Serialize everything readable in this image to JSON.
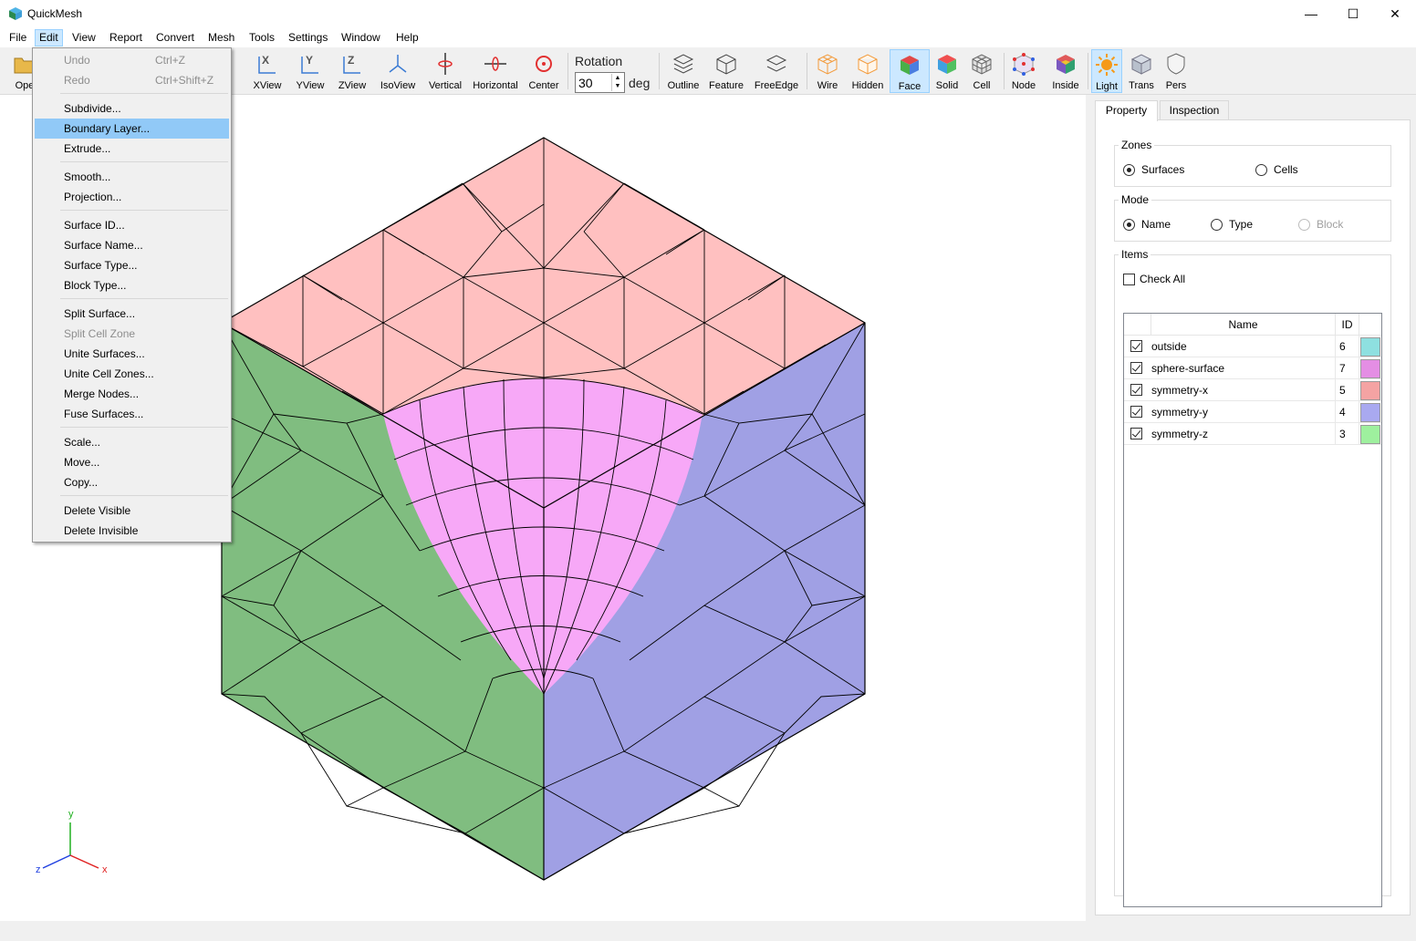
{
  "title": "QuickMesh",
  "menu": [
    "File",
    "Edit",
    "View",
    "Report",
    "Convert",
    "Mesh",
    "Tools",
    "Settings",
    "Window",
    "Help"
  ],
  "toolbar": {
    "open": "Ope",
    "views": [
      "XView",
      "YView",
      "ZView",
      "IsoView"
    ],
    "axes": [
      "Vertical",
      "Horizontal",
      "Center"
    ],
    "rotation_label": "Rotation",
    "rotation_value": "30",
    "rotation_unit": "deg",
    "display": [
      "Outline",
      "Feature",
      "FreeEdge"
    ],
    "render": [
      "Wire",
      "Hidden",
      "Face",
      "Solid",
      "Cell"
    ],
    "extra": [
      "Node",
      "Inside"
    ],
    "light": [
      "Light",
      "Trans",
      "Pers"
    ]
  },
  "edit_menu": {
    "undo": "Undo",
    "undo_sc": "Ctrl+Z",
    "redo": "Redo",
    "redo_sc": "Ctrl+Shift+Z",
    "subdivide": "Subdivide...",
    "boundary_layer": "Boundary Layer...",
    "extrude": "Extrude...",
    "smooth": "Smooth...",
    "projection": "Projection...",
    "surface_id": "Surface ID...",
    "surface_name": "Surface Name...",
    "surface_type": "Surface Type...",
    "block_type": "Block Type...",
    "split_surface": "Split Surface...",
    "split_cell_zone": "Split Cell Zone",
    "unite_surfaces": "Unite Surfaces...",
    "unite_cell_zones": "Unite Cell Zones...",
    "merge_nodes": "Merge Nodes...",
    "fuse_surfaces": "Fuse Surfaces...",
    "scale": "Scale...",
    "move": "Move...",
    "copy": "Copy...",
    "delete_visible": "Delete Visible",
    "delete_invisible": "Delete Invisible"
  },
  "panel": {
    "tabs": [
      "Property",
      "Inspection"
    ],
    "zones_title": "Zones",
    "zones": [
      "Surfaces",
      "Cells"
    ],
    "mode_title": "Mode",
    "mode": [
      "Name",
      "Type",
      "Block"
    ],
    "items_title": "Items",
    "check_all": "Check All",
    "col_name": "Name",
    "col_id": "ID",
    "rows": [
      {
        "name": "outside",
        "id": "6",
        "color": "#8ee0e0"
      },
      {
        "name": "sphere-surface",
        "id": "7",
        "color": "#e48ee4"
      },
      {
        "name": "symmetry-x",
        "id": "5",
        "color": "#f4a3a3"
      },
      {
        "name": "symmetry-y",
        "id": "4",
        "color": "#a9a9f0"
      },
      {
        "name": "symmetry-z",
        "id": "3",
        "color": "#9ef09e"
      }
    ]
  },
  "axes": {
    "y": "y",
    "x": "x",
    "z": "z"
  },
  "colors": {
    "top_face": "#ffc0c0",
    "left_face": "#80bd80",
    "right_face": "#a0a0e4",
    "sphere": "#f7a8f7",
    "accent": "#cce8ff"
  }
}
